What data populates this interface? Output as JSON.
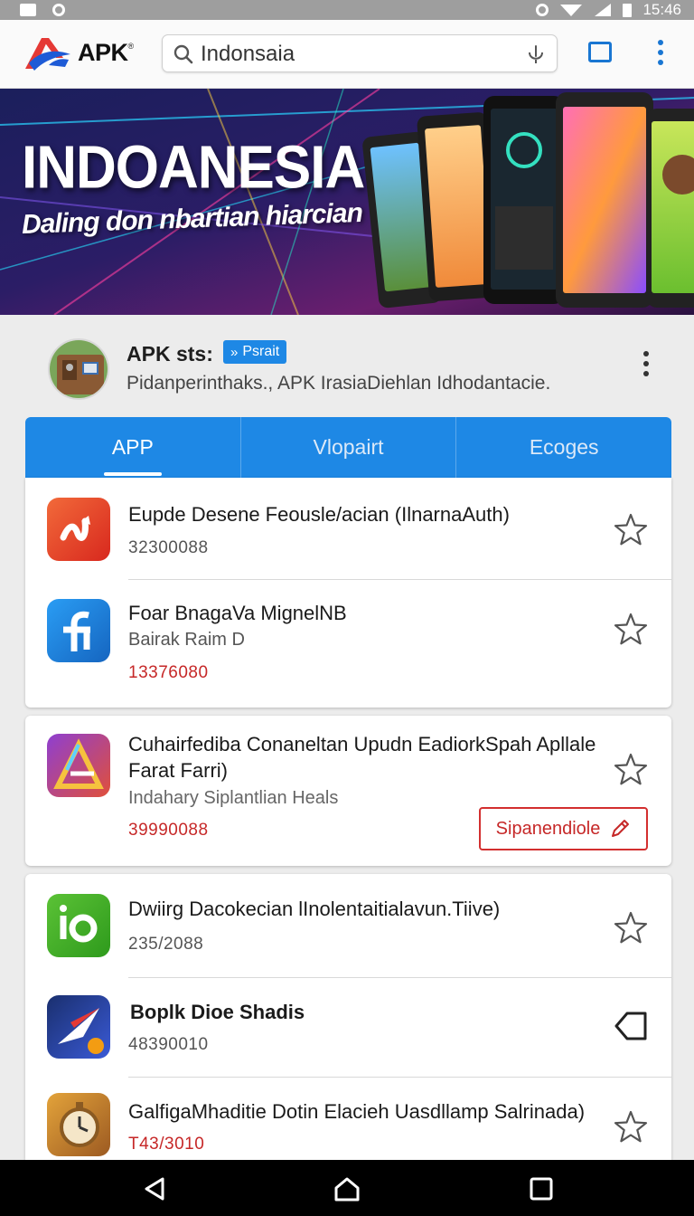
{
  "status_bar": {
    "time": "15:46"
  },
  "app_bar": {
    "logo_text": "APK",
    "search_value": "Indonsaia",
    "icons": [
      "search-icon",
      "mic-icon",
      "tabs-icon",
      "more-vert-icon"
    ]
  },
  "banner": {
    "title": "INDOANESIA",
    "subtitle": "Daling don nbartian hiarcian"
  },
  "profile": {
    "name": "APK sts:",
    "badge": "Psrait",
    "description": "Pidanperinthaks., APK IrasiaDiehlan Idhodantacie."
  },
  "tabs": [
    {
      "label": "APP",
      "active": true
    },
    {
      "label": "Vlopairt",
      "active": false
    },
    {
      "label": "Ecoges",
      "active": false
    }
  ],
  "apps": [
    {
      "title": "Eupde Desene Feousle/acian (IlnarnaAuth)",
      "count": "32300088"
    },
    {
      "title": "Foar BnagaVa MignelNB",
      "subtitle": "Bairak Raim D",
      "count": "13376080"
    },
    {
      "title_line1": "Cuhairfediba Conaneltan Upudn EadiorkSpah Apllale",
      "title_line2": "Farat Farri)",
      "subtitle": "Indahary Siplantlian Heals",
      "count": "39990088",
      "action_label": "Sipanendiole"
    },
    {
      "title": "Dwiirg Dacokecian lInolentaitialavun.Tiive)",
      "count": "235/2088"
    },
    {
      "title": "Boplk Dioe Shadis",
      "count": "48390010"
    },
    {
      "title": "GalfigaMhaditie Dotin Elacieh Uasdllamp Salrinada)",
      "count": "T43/3010"
    }
  ],
  "colors": {
    "accent": "#1e88e5",
    "danger": "#c62828"
  }
}
